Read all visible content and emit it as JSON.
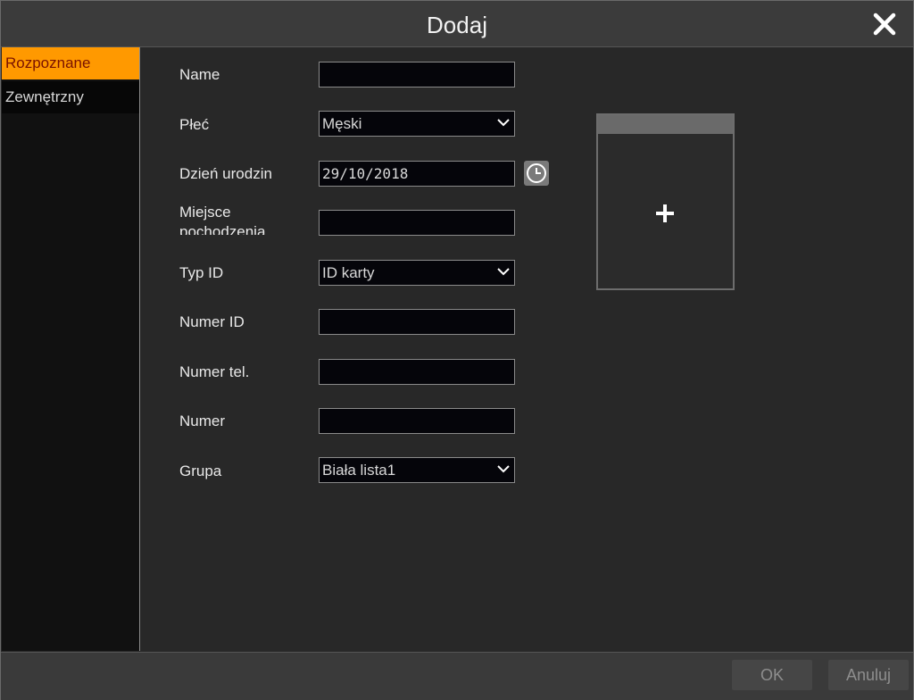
{
  "window": {
    "title": "Dodaj"
  },
  "icons": {
    "close": "close-icon",
    "calendar": "clock-icon",
    "add_photo": "plus-icon",
    "dropdown": "chevron-down-icon"
  },
  "sidebar": {
    "items": [
      {
        "label": "Rozpoznane",
        "active": true
      },
      {
        "label": "Zewnętrzny",
        "active": false
      }
    ]
  },
  "form": {
    "name": {
      "label": "Name",
      "value": ""
    },
    "gender": {
      "label": "Płeć",
      "value": "Męski"
    },
    "birthday": {
      "label": "Dzień urodzin",
      "value": "29/10/2018"
    },
    "birthplace": {
      "label_line1": "Miejsce",
      "label_line2": "pochodzenia",
      "value": ""
    },
    "id_type": {
      "label": "Typ ID",
      "value": "ID karty"
    },
    "id_number": {
      "label": "Numer ID",
      "value": ""
    },
    "phone": {
      "label": "Numer tel.",
      "value": ""
    },
    "number": {
      "label": "Numer",
      "value": ""
    },
    "group": {
      "label": "Grupa",
      "value": "Biała lista1"
    }
  },
  "footer": {
    "ok_label": "OK",
    "cancel_label": "Anuluj"
  },
  "colors": {
    "accent": "#ff9900",
    "active_text": "#7a1200",
    "background": "#282828"
  }
}
